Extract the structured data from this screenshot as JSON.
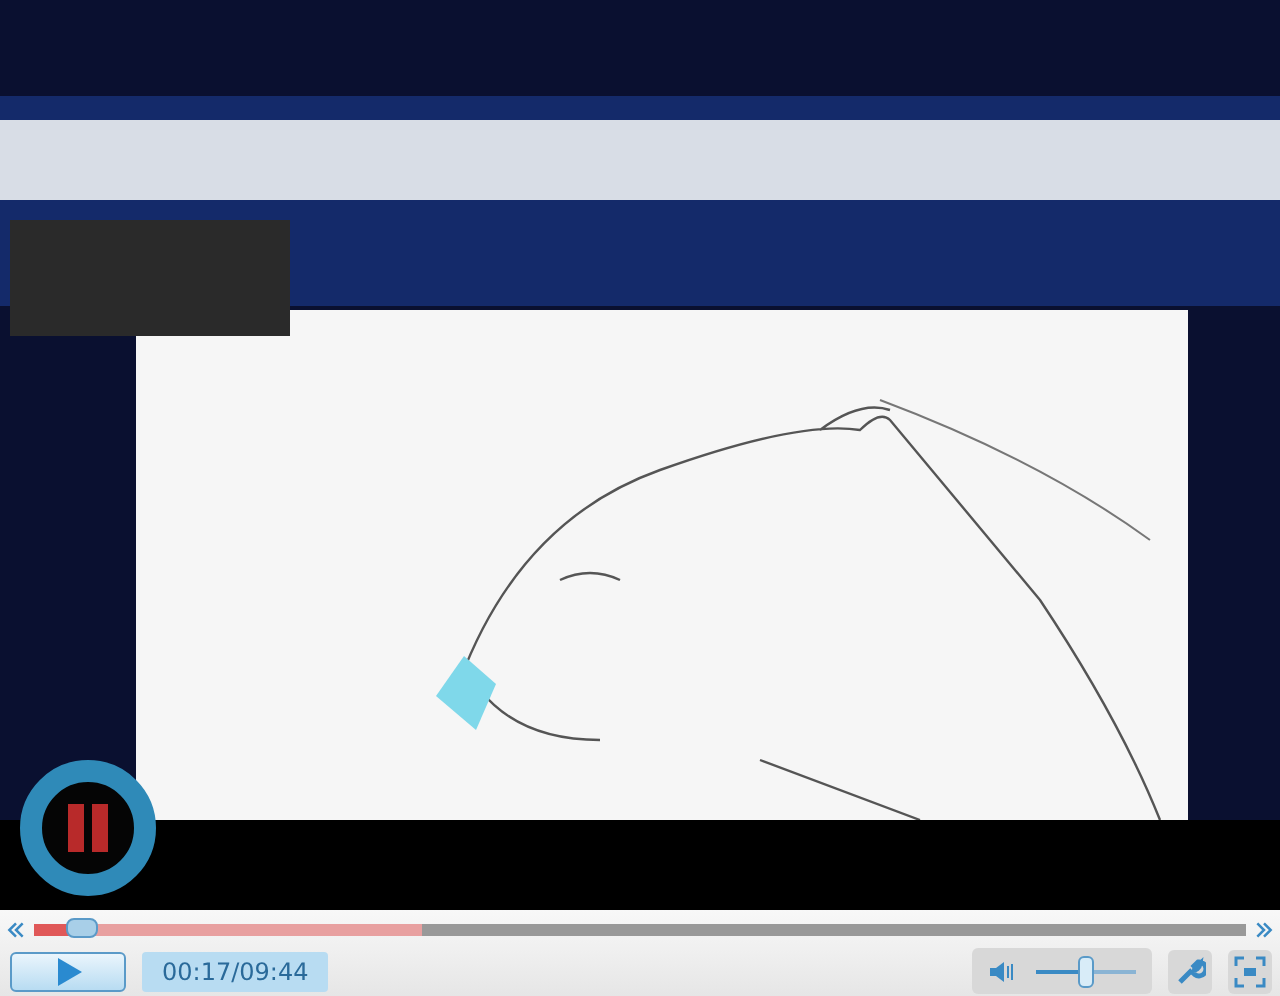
{
  "video": {
    "overlay_button": {
      "kind": "pause"
    }
  },
  "seek_bar": {
    "level": 0.04,
    "buffered": {
      "level": 0.32
    }
  },
  "controls": {
    "play_button": {
      "kind": "play"
    },
    "time": "00:17/09:44",
    "volume": {
      "level": 0.5
    }
  }
}
